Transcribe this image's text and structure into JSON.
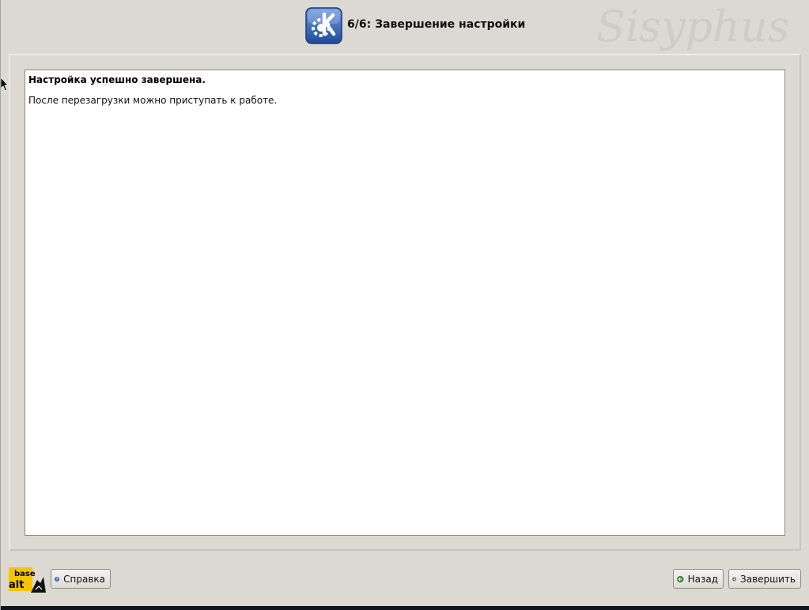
{
  "header": {
    "step_title": "6/6: Завершение настройки",
    "watermark_text": "Sisyphus"
  },
  "content": {
    "message_title": "Настройка успешно завершена.",
    "message_text": "После перезагрузки можно приступать к работе."
  },
  "footer": {
    "logo_text_top": "base",
    "logo_text_bottom": "alt",
    "help_label": "Справка",
    "back_label": "Назад",
    "finish_label": "Завершить"
  },
  "icons": {
    "app_logo": "kde-logo-icon",
    "help": "question-icon",
    "back": "arrow-left-icon",
    "finish": "arrow-down-icon"
  },
  "colors": {
    "window_bg": "#dcd9d2",
    "content_bg": "#ffffff",
    "kde_blue": "#2f5fb3",
    "alt_yellow": "#f5c400",
    "button_icon_green": "#3e8a3a",
    "help_icon_blue": "#3a66c4"
  }
}
